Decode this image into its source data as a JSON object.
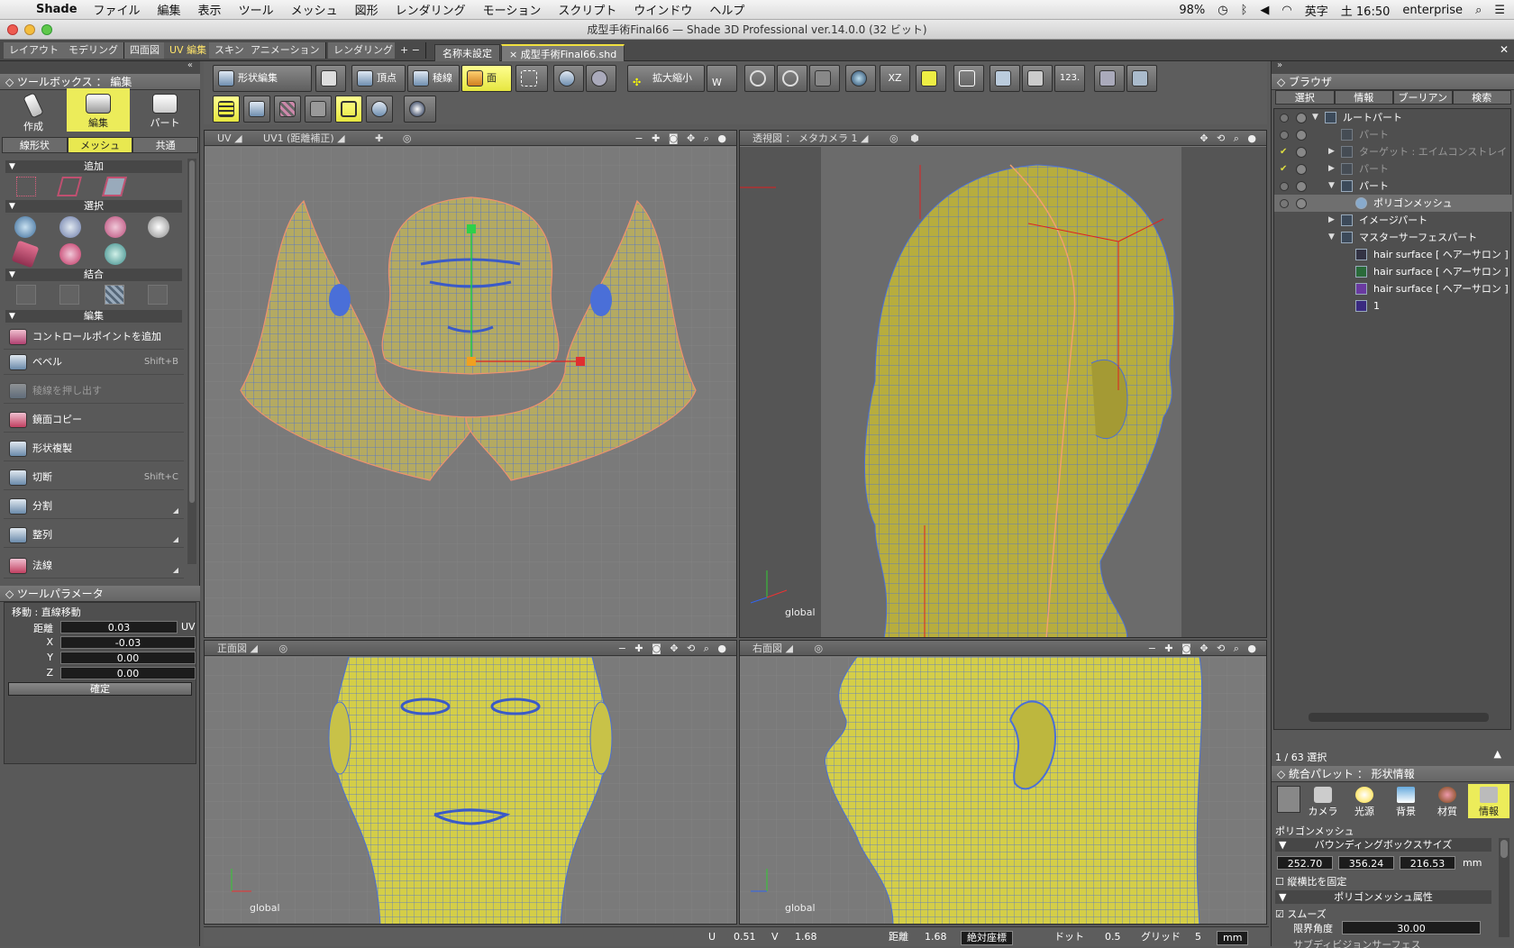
{
  "menubar": {
    "app": "Shade",
    "items": [
      "ファイル",
      "編集",
      "表示",
      "ツール",
      "メッシュ",
      "図形",
      "レンダリング",
      "モーション",
      "スクリプト",
      "ウインドウ",
      "ヘルプ"
    ],
    "battery": "98%",
    "input_mode": "英字",
    "clock": "土 16:50",
    "user": "enterprise"
  },
  "window": {
    "title": "成型手術Final66 — Shade 3D Professional ver.14.0.0 (32 ビット)"
  },
  "workspace_tabs": [
    "レイアウト",
    "モデリング",
    "四面図",
    "UV 編集",
    "スキン",
    "アニメーション",
    "レンダリング",
    "+ −"
  ],
  "workspace_selected": "UV 編集",
  "doc_tabs": {
    "untitled": "名称未設定",
    "active": "× 成型手術Final66.shd"
  },
  "toolbox": {
    "title": "ツールボックス ： 編集",
    "modes": [
      "作成",
      "編集",
      "パート"
    ],
    "subtabs": [
      "線形状",
      "メッシュ",
      "共通"
    ],
    "sections": {
      "add": "追加",
      "select": "選択",
      "combine": "結合",
      "edit": "編集"
    },
    "items": [
      {
        "label": "コントロールポイントを追加",
        "shortcut": ""
      },
      {
        "label": "ベベル",
        "shortcut": "Shift+B"
      },
      {
        "label": "稜線を押し出す",
        "shortcut": ""
      },
      {
        "label": "鏡面コピー",
        "shortcut": ""
      },
      {
        "label": "形状複製",
        "shortcut": ""
      },
      {
        "label": "切断",
        "shortcut": "Shift+C"
      },
      {
        "label": "分割",
        "shortcut": ""
      },
      {
        "label": "整列",
        "shortcut": ""
      },
      {
        "label": "法線",
        "shortcut": ""
      }
    ]
  },
  "toolparams": {
    "title": "ツールパラメータ",
    "mode": "移動 : 直線移動",
    "distance_label": "距離",
    "distance": "0.03",
    "distance_unit": "UV",
    "x_label": "X",
    "x": "-0.03",
    "y_label": "Y",
    "y": "0.00",
    "z_label": "Z",
    "z": "0.00",
    "confirm": "確定"
  },
  "toolbar": {
    "shape_edit": "形状編集",
    "vertex": "頂点",
    "edge": "稜線",
    "face": "面",
    "scale": "拡大縮小",
    "xz": "XZ",
    "num": "123."
  },
  "viewports": {
    "uv": {
      "title": "UV",
      "mode": "UV1 (距離補正)"
    },
    "persp": {
      "title": "透視図 ： メタカメラ 1",
      "coord": "global"
    },
    "front": {
      "title": "正面図",
      "coord": "global"
    },
    "right": {
      "title": "右面図",
      "coord": "global"
    }
  },
  "browser": {
    "title": "ブラウザ",
    "tabs": [
      "選択",
      "情報",
      "ブーリアン",
      "検索"
    ],
    "tree": [
      {
        "label": "ルートパート",
        "indent": 0
      },
      {
        "label": "パート",
        "indent": 1,
        "disabled": true
      },
      {
        "label": "ターゲット : エイムコンストレイ",
        "indent": 1,
        "disabled": true
      },
      {
        "label": "パート",
        "indent": 1,
        "disabled": true
      },
      {
        "label": "パート",
        "indent": 1
      },
      {
        "label": "ポリゴンメッシュ",
        "indent": 2,
        "selected": true
      },
      {
        "label": "イメージパート",
        "indent": 1
      },
      {
        "label": "マスターサーフェスパート",
        "indent": 1
      },
      {
        "label": "hair surface [ ヘアーサロン ]",
        "indent": 2
      },
      {
        "label": "hair surface [ ヘアーサロン ]",
        "indent": 2
      },
      {
        "label": "hair surface [ ヘアーサロン ]",
        "indent": 2
      },
      {
        "label": "1",
        "indent": 2
      }
    ],
    "selection_count": "1 / 63 選択"
  },
  "palette": {
    "title": "統合パレット ： 形状情報",
    "tabs": [
      "カメラ",
      "光源",
      "背景",
      "材質",
      "情報"
    ],
    "shape_type": "ポリゴンメッシュ",
    "bbox_title": "バウンディングボックスサイズ",
    "bbox": [
      "252.70",
      "356.24",
      "216.53"
    ],
    "bbox_unit": "mm",
    "keep_ratio": "縦横比を固定",
    "attr_title": "ポリゴンメッシュ属性",
    "smooth": "スムーズ",
    "limit_angle_label": "限界角度",
    "limit_angle": "30.00",
    "subdiv": "サブディビジョンサーフェス"
  },
  "statusbar": {
    "u_label": "U",
    "u": "0.51",
    "v_label": "V",
    "v": "1.68",
    "dist_label": "距離",
    "dist": "1.68",
    "coord_mode": "絶対座標",
    "dot_label": "ドット",
    "dot": "0.5",
    "grid_label": "グリッド",
    "grid": "5",
    "unit": "mm"
  },
  "colors": {
    "highlight": "#ecec5a",
    "mesh_fill": "#c8c24a",
    "wire": "#4a6fd8",
    "seam": "#e89060"
  }
}
